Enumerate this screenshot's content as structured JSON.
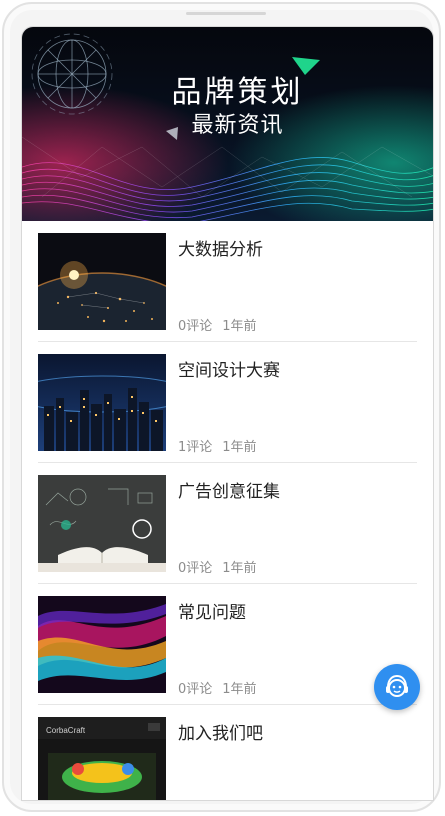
{
  "banner": {
    "title": "品牌策划",
    "subtitle": "最新资讯"
  },
  "articles": [
    {
      "title": "大数据分析",
      "comments": "0评论",
      "time": "1年前",
      "thumb_icon": "city-lights-earth"
    },
    {
      "title": "空间设计大赛",
      "comments": "1评论",
      "time": "1年前",
      "thumb_icon": "night-city-skyline"
    },
    {
      "title": "广告创意征集",
      "comments": "0评论",
      "time": "1年前",
      "thumb_icon": "open-book-chalkboard"
    },
    {
      "title": "常见问题",
      "comments": "0评论",
      "time": "1年前",
      "thumb_icon": "colorful-abstract"
    },
    {
      "title": "加入我们吧",
      "comments": "",
      "time": "",
      "thumb_icon": "game-screenshot",
      "thumb_label": "CorbaCraft"
    }
  ],
  "support_button": {
    "icon": "customer-service-icon"
  },
  "colors": {
    "accent": "#2f8ff0",
    "meta_text": "#8c8c8c",
    "title_text": "#222222"
  }
}
